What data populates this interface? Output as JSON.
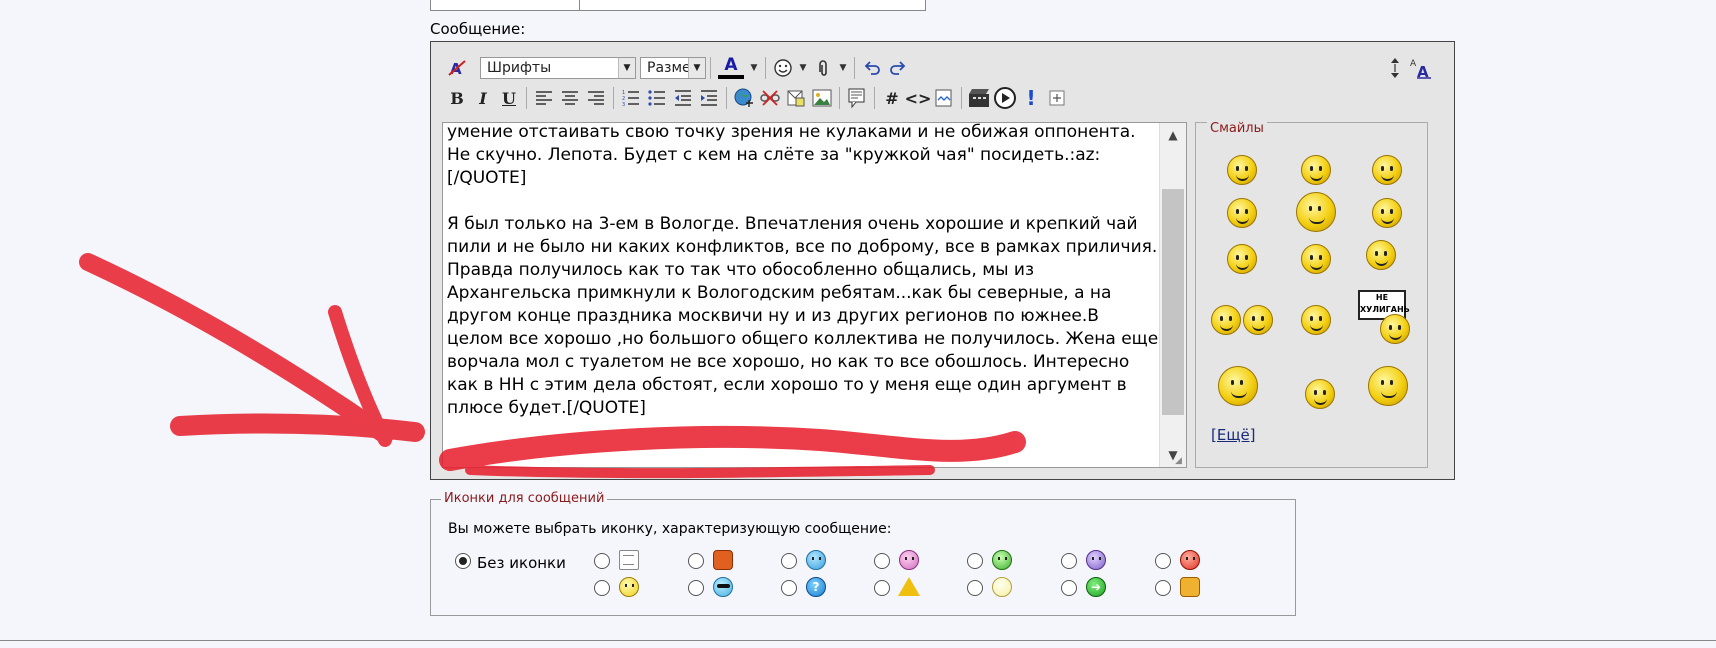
{
  "labels": {
    "message": "Сообщение:",
    "smileys_legend": "Смайлы",
    "more_smileys": "[Ещё]",
    "icons_legend": "Иконки для сообщений",
    "icons_description": "Вы можете выбрать иконку, характеризующую сообщение:",
    "no_icon": "Без иконки"
  },
  "toolbar": {
    "font_select": "Шрифты",
    "size_select": "Разме",
    "font_color_glyph": "A",
    "bold": "B",
    "italic": "I",
    "underline": "U"
  },
  "editor": {
    "content": "умение отстаивать свою точку зрения не кулаками и не обижая оппонента. Не скучно. Лепота. Будет с кем на слёте за \"кружкой чая\" посидеть.:az:[/QUOTE]\n\nЯ был только на 3-ем в Вологде. Впечатления очень хорошие и крепкий чай пили и не было ни каких конфликтов, все по доброму, все в рамках приличия. Правда получилось как то так что обособленно общались, мы из Архангельска примкнули к Вологодским ребятам...как бы северные, а на другом конце праздника москвичи ну и из других регионов по южнее.В целом все хорошо ,но большого общего коллектива не получилось. Жена еще ворчала мол с туалетом не все хорошо, но как то все обошлось. Интересно как в НН с этим дела обстоят, если хорошо то у меня еще один аргумент в плюсе будет.[/QUOTE]"
  },
  "smileys": {
    "sign_text": "НЕ ХУЛИГАНЬ"
  },
  "post_icons": {
    "selected": "no_icon"
  },
  "colors": {
    "accent_red": "#e81c2a",
    "legend_text": "#8b1a1a",
    "link": "#1a2a7a"
  }
}
